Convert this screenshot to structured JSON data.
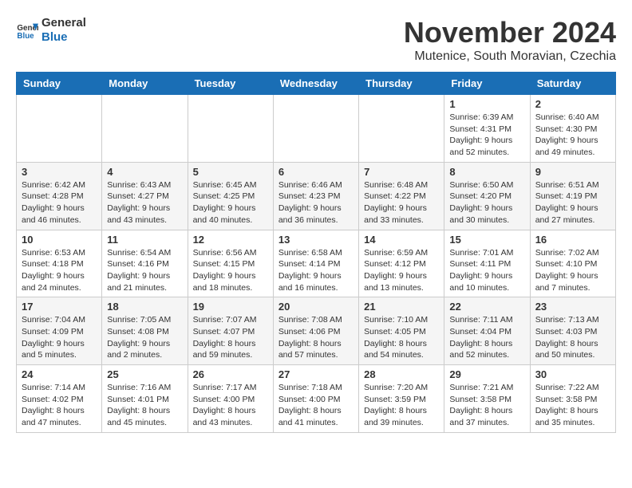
{
  "logo": {
    "line1": "General",
    "line2": "Blue"
  },
  "title": "November 2024",
  "location": "Mutenice, South Moravian, Czechia",
  "weekdays": [
    "Sunday",
    "Monday",
    "Tuesday",
    "Wednesday",
    "Thursday",
    "Friday",
    "Saturday"
  ],
  "weeks": [
    [
      {
        "day": "",
        "info": ""
      },
      {
        "day": "",
        "info": ""
      },
      {
        "day": "",
        "info": ""
      },
      {
        "day": "",
        "info": ""
      },
      {
        "day": "",
        "info": ""
      },
      {
        "day": "1",
        "info": "Sunrise: 6:39 AM\nSunset: 4:31 PM\nDaylight: 9 hours\nand 52 minutes."
      },
      {
        "day": "2",
        "info": "Sunrise: 6:40 AM\nSunset: 4:30 PM\nDaylight: 9 hours\nand 49 minutes."
      }
    ],
    [
      {
        "day": "3",
        "info": "Sunrise: 6:42 AM\nSunset: 4:28 PM\nDaylight: 9 hours\nand 46 minutes."
      },
      {
        "day": "4",
        "info": "Sunrise: 6:43 AM\nSunset: 4:27 PM\nDaylight: 9 hours\nand 43 minutes."
      },
      {
        "day": "5",
        "info": "Sunrise: 6:45 AM\nSunset: 4:25 PM\nDaylight: 9 hours\nand 40 minutes."
      },
      {
        "day": "6",
        "info": "Sunrise: 6:46 AM\nSunset: 4:23 PM\nDaylight: 9 hours\nand 36 minutes."
      },
      {
        "day": "7",
        "info": "Sunrise: 6:48 AM\nSunset: 4:22 PM\nDaylight: 9 hours\nand 33 minutes."
      },
      {
        "day": "8",
        "info": "Sunrise: 6:50 AM\nSunset: 4:20 PM\nDaylight: 9 hours\nand 30 minutes."
      },
      {
        "day": "9",
        "info": "Sunrise: 6:51 AM\nSunset: 4:19 PM\nDaylight: 9 hours\nand 27 minutes."
      }
    ],
    [
      {
        "day": "10",
        "info": "Sunrise: 6:53 AM\nSunset: 4:18 PM\nDaylight: 9 hours\nand 24 minutes."
      },
      {
        "day": "11",
        "info": "Sunrise: 6:54 AM\nSunset: 4:16 PM\nDaylight: 9 hours\nand 21 minutes."
      },
      {
        "day": "12",
        "info": "Sunrise: 6:56 AM\nSunset: 4:15 PM\nDaylight: 9 hours\nand 18 minutes."
      },
      {
        "day": "13",
        "info": "Sunrise: 6:58 AM\nSunset: 4:14 PM\nDaylight: 9 hours\nand 16 minutes."
      },
      {
        "day": "14",
        "info": "Sunrise: 6:59 AM\nSunset: 4:12 PM\nDaylight: 9 hours\nand 13 minutes."
      },
      {
        "day": "15",
        "info": "Sunrise: 7:01 AM\nSunset: 4:11 PM\nDaylight: 9 hours\nand 10 minutes."
      },
      {
        "day": "16",
        "info": "Sunrise: 7:02 AM\nSunset: 4:10 PM\nDaylight: 9 hours\nand 7 minutes."
      }
    ],
    [
      {
        "day": "17",
        "info": "Sunrise: 7:04 AM\nSunset: 4:09 PM\nDaylight: 9 hours\nand 5 minutes."
      },
      {
        "day": "18",
        "info": "Sunrise: 7:05 AM\nSunset: 4:08 PM\nDaylight: 9 hours\nand 2 minutes."
      },
      {
        "day": "19",
        "info": "Sunrise: 7:07 AM\nSunset: 4:07 PM\nDaylight: 8 hours\nand 59 minutes."
      },
      {
        "day": "20",
        "info": "Sunrise: 7:08 AM\nSunset: 4:06 PM\nDaylight: 8 hours\nand 57 minutes."
      },
      {
        "day": "21",
        "info": "Sunrise: 7:10 AM\nSunset: 4:05 PM\nDaylight: 8 hours\nand 54 minutes."
      },
      {
        "day": "22",
        "info": "Sunrise: 7:11 AM\nSunset: 4:04 PM\nDaylight: 8 hours\nand 52 minutes."
      },
      {
        "day": "23",
        "info": "Sunrise: 7:13 AM\nSunset: 4:03 PM\nDaylight: 8 hours\nand 50 minutes."
      }
    ],
    [
      {
        "day": "24",
        "info": "Sunrise: 7:14 AM\nSunset: 4:02 PM\nDaylight: 8 hours\nand 47 minutes."
      },
      {
        "day": "25",
        "info": "Sunrise: 7:16 AM\nSunset: 4:01 PM\nDaylight: 8 hours\nand 45 minutes."
      },
      {
        "day": "26",
        "info": "Sunrise: 7:17 AM\nSunset: 4:00 PM\nDaylight: 8 hours\nand 43 minutes."
      },
      {
        "day": "27",
        "info": "Sunrise: 7:18 AM\nSunset: 4:00 PM\nDaylight: 8 hours\nand 41 minutes."
      },
      {
        "day": "28",
        "info": "Sunrise: 7:20 AM\nSunset: 3:59 PM\nDaylight: 8 hours\nand 39 minutes."
      },
      {
        "day": "29",
        "info": "Sunrise: 7:21 AM\nSunset: 3:58 PM\nDaylight: 8 hours\nand 37 minutes."
      },
      {
        "day": "30",
        "info": "Sunrise: 7:22 AM\nSunset: 3:58 PM\nDaylight: 8 hours\nand 35 minutes."
      }
    ]
  ]
}
